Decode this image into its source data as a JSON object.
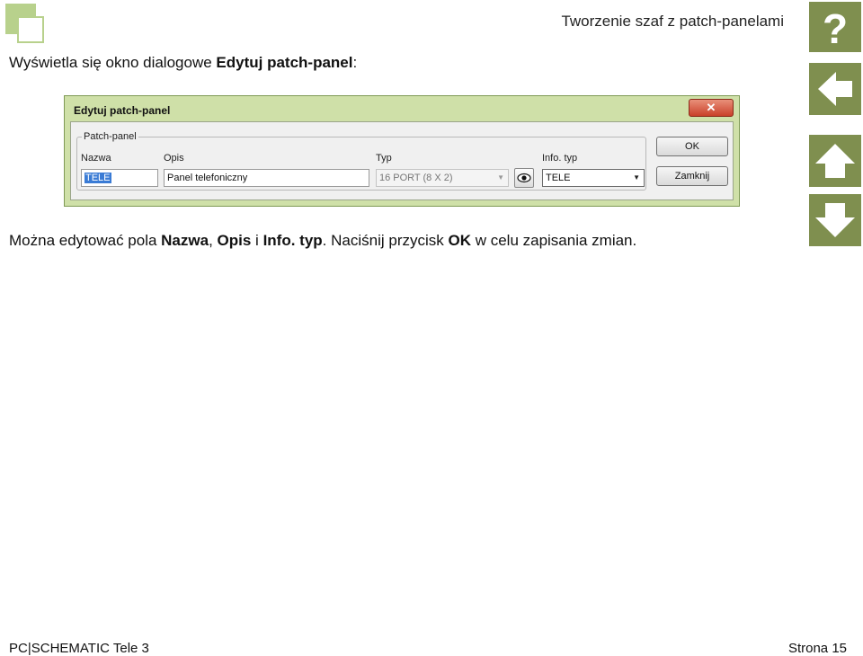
{
  "header": {
    "title": "Tworzenie szaf z patch-panelami"
  },
  "intro": {
    "prefix": "Wyświetla się okno dialogowe ",
    "bold": "Edytuj patch-panel",
    "suffix": ":"
  },
  "dialog": {
    "title": "Edytuj patch-panel",
    "close_glyph": "✕",
    "group_label": "Patch-panel",
    "fields": {
      "name": {
        "label": "Nazwa",
        "value": "TELE"
      },
      "description": {
        "label": "Opis",
        "value": "Panel telefoniczny"
      },
      "type": {
        "label": "Typ",
        "value": "16 PORT (8 X 2)"
      },
      "info_type": {
        "label": "Info. typ",
        "value": "TELE"
      }
    },
    "buttons": {
      "ok": "OK",
      "close": "Zamknij"
    }
  },
  "body": {
    "t1": "Można edytować pola ",
    "b1": "Nazwa",
    "t2": ", ",
    "b2": "Opis",
    "t3": " i ",
    "b3": "Info. typ",
    "t4": ". Naciśnij przycisk ",
    "b4": "OK",
    "t5": " w celu zapisania zmian."
  },
  "nav": {
    "help_glyph": "?",
    "icons": [
      "help-icon",
      "arrow-left-icon",
      "arrow-up-icon",
      "arrow-down-icon"
    ],
    "accent": "#7f8f4f"
  },
  "footer": {
    "product": "PC|SCHEMATIC Tele 3",
    "page": "Strona 15"
  },
  "colors": {
    "logo": "#b8d18c",
    "dialog_frame": "#cfe0a8",
    "selection": "#3a7bd5"
  }
}
